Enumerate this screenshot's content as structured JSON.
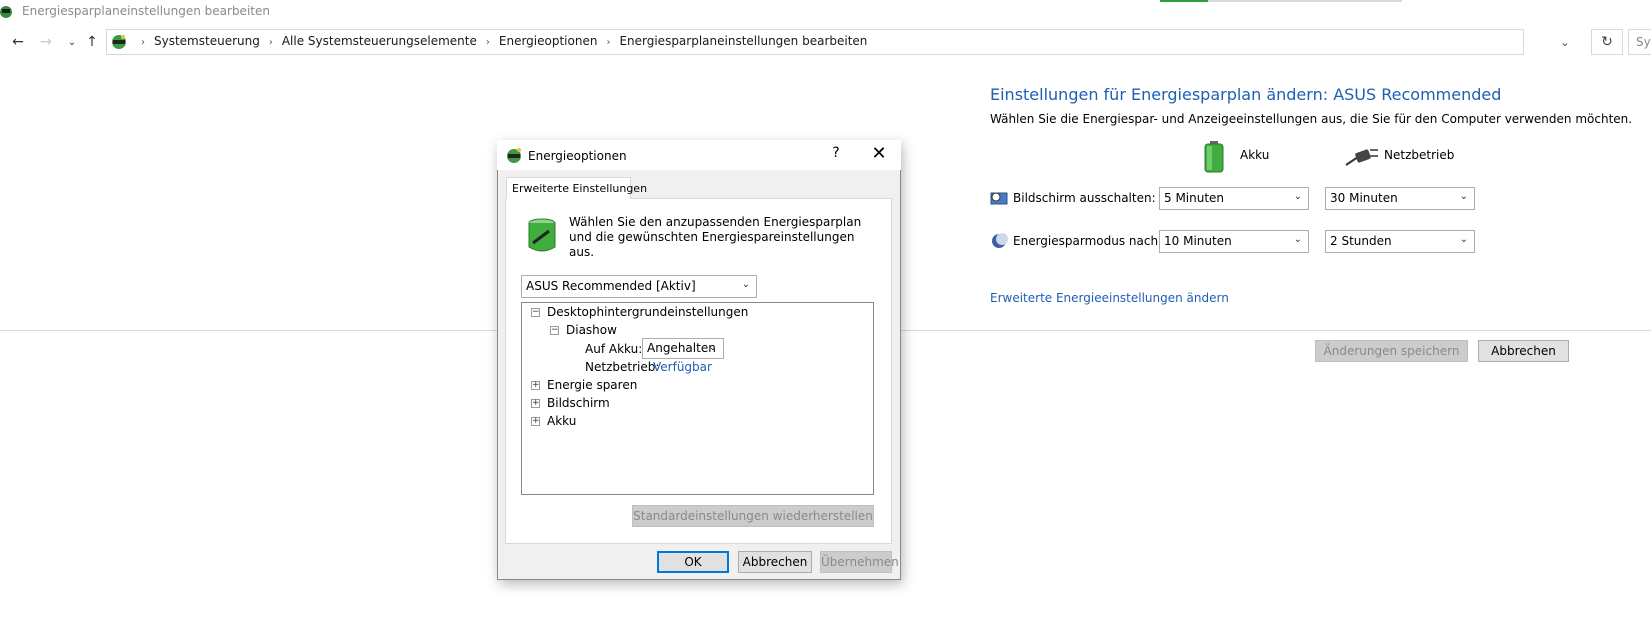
{
  "window": {
    "title": "Energiesparplaneinstellungen bearbeiten"
  },
  "address_bar": {
    "breadcrumb": [
      "Systemsteuerung",
      "Alle Systemsteuerungselemente",
      "Energieoptionen",
      "Energiesparplaneinstellungen bearbeiten"
    ],
    "search_placeholder": "Sys"
  },
  "plan": {
    "title": "Einstellungen für Energiesparplan ändern: ASUS Recommended",
    "description": "Wählen Sie die Energiespar- und Anzeigeeinstellungen aus, die Sie für den Computer verwenden möchten.",
    "col_akku": "Akku",
    "col_netz": "Netzbetrieb",
    "rows": [
      {
        "label": "Bildschirm ausschalten:",
        "akku": "5 Minuten",
        "netz": "30 Minuten"
      },
      {
        "label": "Energiesparmodus nach:",
        "akku": "10 Minuten",
        "netz": "2 Stunden"
      }
    ],
    "advanced_link": "Erweiterte Energieeinstellungen ändern",
    "save_button": "Änderungen speichern",
    "cancel_button": "Abbrechen"
  },
  "dialog": {
    "title": "Energieoptionen",
    "help": "?",
    "close": "✕",
    "tab": "Erweiterte Einstellungen",
    "description": "Wählen Sie den anzupassenden Energiesparplan und die gewünschten Energiespareinstellungen aus.",
    "plan_select": "ASUS Recommended [Aktiv]",
    "tree": {
      "n1": "Desktophintergrundeinstellungen",
      "n2": "Diashow",
      "n3_label": "Auf Akku:",
      "n3_value": "Angehalten",
      "n4_label": "Netzbetrieb:",
      "n4_value": "Verfügbar",
      "n5": "Energie sparen",
      "n6": "Bildschirm",
      "n7": "Akku"
    },
    "restore_button": "Standardeinstellungen wiederherstellen",
    "ok_button": "OK",
    "cancel_button": "Abbrechen",
    "apply_button": "Übernehmen"
  },
  "colors": {
    "link": "#1e5fb4",
    "accent": "#0078d7"
  }
}
